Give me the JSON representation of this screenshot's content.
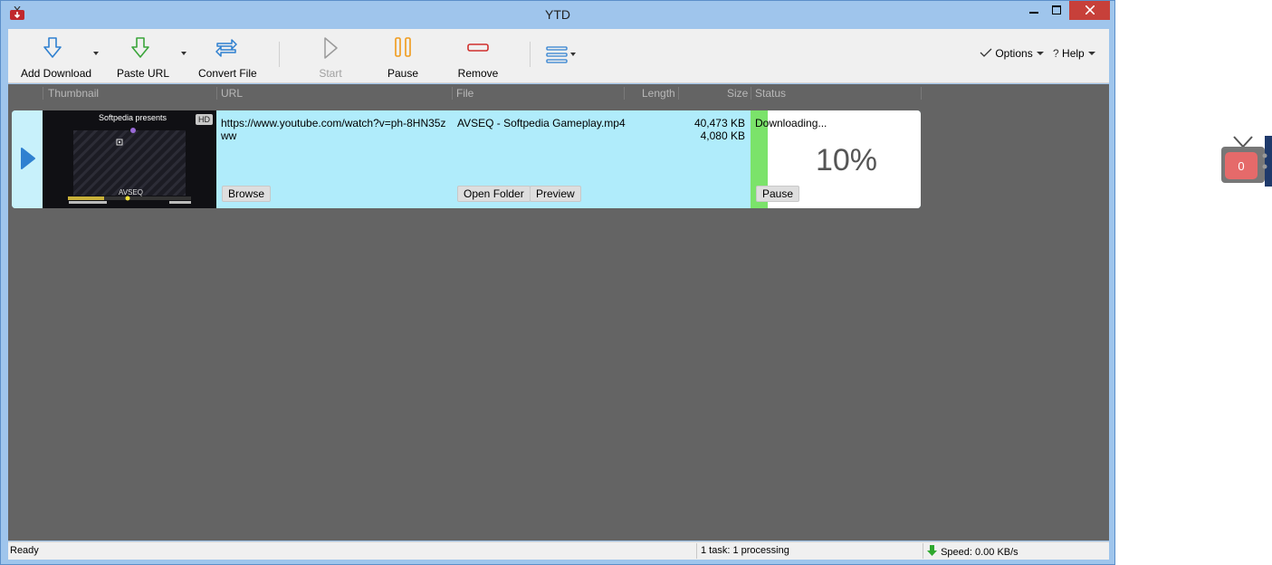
{
  "window": {
    "title": "YTD"
  },
  "toolbar": {
    "add_download": "Add Download",
    "paste_url": "Paste URL",
    "convert_file": "Convert File",
    "start": "Start",
    "pause": "Pause",
    "remove": "Remove",
    "options": "Options",
    "help": "Help"
  },
  "columns": {
    "thumbnail": "Thumbnail",
    "url": "URL",
    "file": "File",
    "length": "Length",
    "size": "Size",
    "status": "Status"
  },
  "download": {
    "hd_badge": "HD",
    "thumb_title": "Softpedia presents",
    "thumb_caption": "AVSEQ",
    "url": "https://www.youtube.com/watch?v=ph-8HN35zww",
    "file": "AVSEQ - Softpedia Gameplay.mp4",
    "size_total": "40,473 KB",
    "size_done": "4,080 KB",
    "status": "Downloading...",
    "percent": "10%",
    "progress": 0.1,
    "browse_label": "Browse",
    "open_folder_label": "Open Folder",
    "preview_label": "Preview",
    "pause_label": "Pause"
  },
  "statusbar": {
    "ready": "Ready",
    "tasks": "1 task: 1 processing",
    "speed": "Speed: 0.00 KB/s"
  },
  "widget": {
    "count": "0"
  },
  "colors": {
    "accent": "#2f80d0",
    "progress": "#7be36a",
    "row_bg": "#b0ecfb",
    "close": "#c7403a"
  }
}
